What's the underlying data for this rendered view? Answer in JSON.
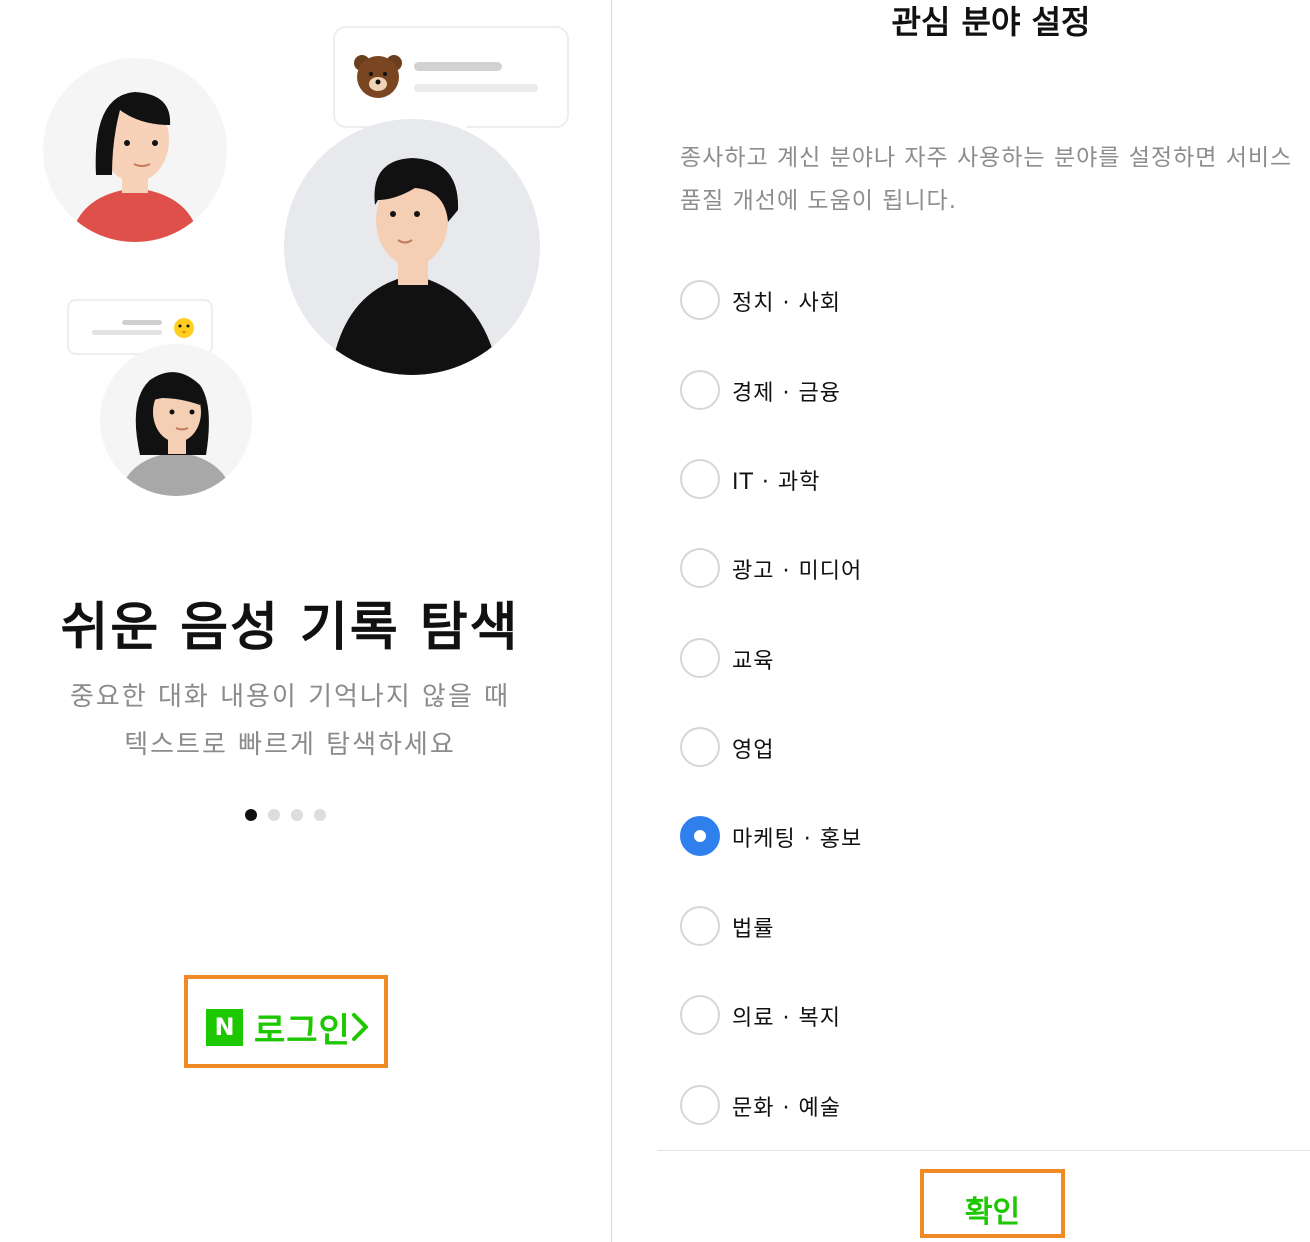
{
  "onboarding": {
    "title": "쉬운 음성 기록 탐색",
    "description_line1": "중요한 대화 내용이 기억나지 않을 때",
    "description_line2": "텍스트로 빠르게 탐색하세요",
    "pager": {
      "total": 4,
      "current": 1
    },
    "login": {
      "logo_letter": "N",
      "label": "로그인",
      "brand_color": "#1ec800"
    }
  },
  "interests": {
    "title": "관심 분야 설정",
    "description_line1": "종사하고 계신 분야나 자주 사용하는 분야를 설정하면 서비스",
    "description_line2": "품질 개선에 도움이 됩니다.",
    "options": [
      {
        "label": "정치 · 사회",
        "selected": false
      },
      {
        "label": "경제 · 금융",
        "selected": false
      },
      {
        "label": "IT · 과학",
        "selected": false
      },
      {
        "label": "광고 · 미디어",
        "selected": false
      },
      {
        "label": "교육",
        "selected": false
      },
      {
        "label": "영업",
        "selected": false
      },
      {
        "label": "마케팅 · 홍보",
        "selected": true
      },
      {
        "label": "법률",
        "selected": false
      },
      {
        "label": "의료 · 복지",
        "selected": false
      },
      {
        "label": "문화 · 예술",
        "selected": false
      }
    ],
    "confirm_label": "확인",
    "selected_color": "#2f80ed",
    "highlight_color": "#f08a24"
  }
}
